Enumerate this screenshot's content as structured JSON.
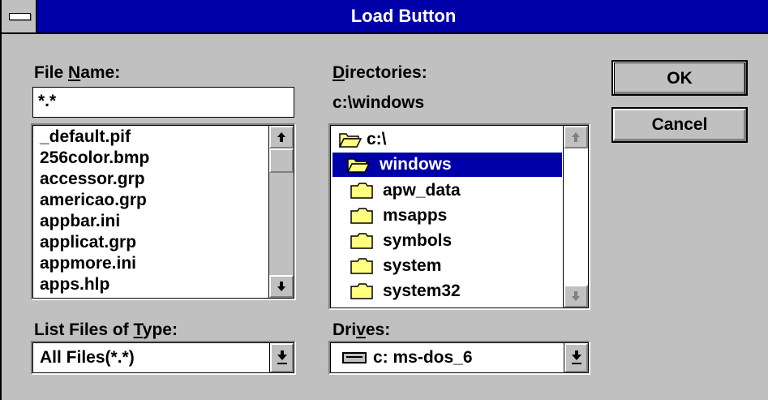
{
  "window": {
    "title": "Load Button"
  },
  "file_name": {
    "label_prefix": "File ",
    "label_access_key": "N",
    "label_suffix": "ame:",
    "value": "*.*"
  },
  "files": [
    "_default.pif",
    "256color.bmp",
    "accessor.grp",
    "americao.grp",
    "appbar.ini",
    "applicat.grp",
    "appmore.ini",
    "apps.hlp"
  ],
  "directories": {
    "label_access_key": "D",
    "label_suffix": "irectories:",
    "current_path": "c:\\windows",
    "root": "c:\\",
    "selected": "windows",
    "subfolders": [
      "apw_data",
      "msapps",
      "symbols",
      "system",
      "system32"
    ]
  },
  "file_type": {
    "label_prefix": "List Files of ",
    "label_access_key": "T",
    "label_suffix": "ype:",
    "value": "All Files(*.*)"
  },
  "drives": {
    "label_prefix": "Dri",
    "label_access_key": "v",
    "label_suffix": "es:",
    "value": "c: ms-dos_6"
  },
  "buttons": {
    "ok": "OK",
    "cancel": "Cancel"
  },
  "icons": {
    "system_menu": "system-menu-icon",
    "folder_open": "folder-open-icon",
    "folder": "folder-icon",
    "drive": "drive-icon"
  },
  "colors": {
    "titlebar": "#0000a8",
    "face": "#c0c0c0",
    "selection": "#0000a8"
  }
}
